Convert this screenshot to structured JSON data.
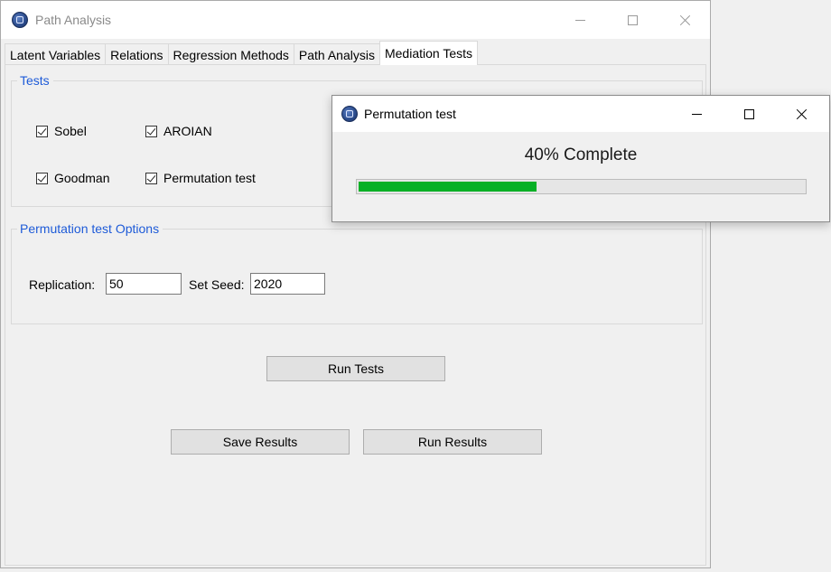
{
  "window": {
    "title": "Path Analysis",
    "controls": [
      "minimize",
      "maximize",
      "close"
    ]
  },
  "tabs": [
    {
      "label": "Latent Variables",
      "active": false
    },
    {
      "label": "Relations",
      "active": false
    },
    {
      "label": "Regression Methods",
      "active": false
    },
    {
      "label": "Path Analysis",
      "active": false
    },
    {
      "label": "Mediation Tests",
      "active": true
    }
  ],
  "tests_group": {
    "legend": "Tests",
    "checkboxes": [
      {
        "label": "Sobel",
        "checked": true
      },
      {
        "label": "AROIAN",
        "checked": true
      },
      {
        "label": "Goodman",
        "checked": true
      },
      {
        "label": "Permutation test",
        "checked": true
      }
    ]
  },
  "permutation_group": {
    "legend": "Permutation test Options",
    "replication_label": "Replication:",
    "replication_value": "50",
    "seed_label": "Set Seed:",
    "seed_value": "2020"
  },
  "buttons": {
    "run_tests": "Run Tests",
    "save_results": "Save Results",
    "run_results": "Run Results"
  },
  "dialog": {
    "title": "Permutation test",
    "progress_text": "40% Complete",
    "progress_fraction": 0.4,
    "progress_color": "#06b025"
  },
  "colors": {
    "accent_legend": "#1e5bd8",
    "window_bg": "#f0f0f0"
  }
}
